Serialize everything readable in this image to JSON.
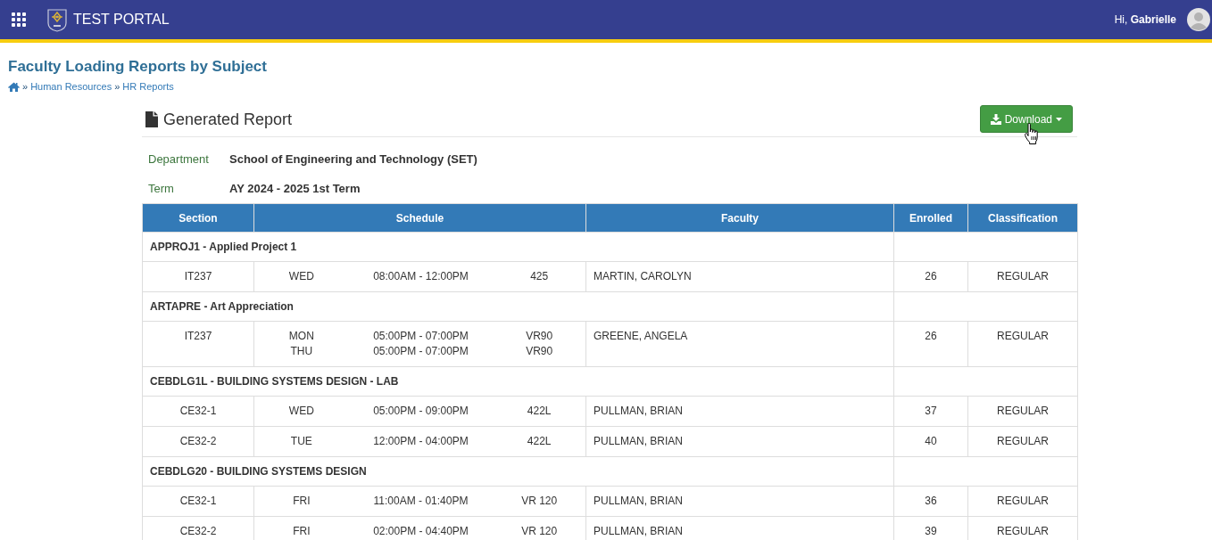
{
  "header": {
    "title": "TEST PORTAL",
    "greeting": "Hi, **Gabrielle**"
  },
  "page": {
    "title": "Faculty Loading Reports by Subject",
    "breadcrumbs": [
      {
        "kind": "home"
      },
      {
        "kind": "separator",
        "text": "»"
      },
      {
        "kind": "link",
        "text": "Human Resources"
      },
      {
        "kind": "separator",
        "text": "»"
      },
      {
        "kind": "link",
        "text": "HR Reports"
      }
    ]
  },
  "report": {
    "title": "Generated Report",
    "download_button": "Download",
    "details": [
      {
        "label": "Department",
        "value": "School of Engineering and Technology (SET)"
      },
      {
        "label": "Term",
        "value": "AY 2024 - 2025 1st Term"
      }
    ]
  },
  "table": {
    "columns": [
      "Section",
      "Schedule",
      "Faculty",
      "Enrolled",
      "Classification"
    ],
    "groups": [
      {
        "subject": "APPROJ1 - Applied Project 1",
        "rows": [
          {
            "section": "IT237",
            "schedule": [
              {
                "day": "WED",
                "time": "08:00AM - 12:00PM",
                "room": "425"
              }
            ],
            "faculty": "MARTIN, CAROLYN",
            "enrolled": "26",
            "classification": "REGULAR"
          }
        ]
      },
      {
        "subject": "ARTAPRE - Art Appreciation",
        "rows": [
          {
            "section": "IT237",
            "schedule": [
              {
                "day": "MON",
                "time": "05:00PM - 07:00PM",
                "room": "VR90"
              },
              {
                "day": "THU",
                "time": "05:00PM - 07:00PM",
                "room": "VR90"
              }
            ],
            "faculty": "GREENE, ANGELA",
            "enrolled": "26",
            "classification": "REGULAR"
          }
        ]
      },
      {
        "subject": "CEBDLG1L - BUILDING SYSTEMS DESIGN - LAB",
        "rows": [
          {
            "section": "CE32-1",
            "schedule": [
              {
                "day": "WED",
                "time": "05:00PM - 09:00PM",
                "room": "422L"
              }
            ],
            "faculty": "PULLMAN, BRIAN",
            "enrolled": "37",
            "classification": "REGULAR"
          },
          {
            "section": "CE32-2",
            "schedule": [
              {
                "day": "TUE",
                "time": "12:00PM - 04:00PM",
                "room": "422L"
              }
            ],
            "faculty": "PULLMAN, BRIAN",
            "enrolled": "40",
            "classification": "REGULAR"
          }
        ]
      },
      {
        "subject": "CEBDLG20 - BUILDING SYSTEMS DESIGN",
        "rows": [
          {
            "section": "CE32-1",
            "schedule": [
              {
                "day": "FRI",
                "time": "11:00AM - 01:40PM",
                "room": "VR 120"
              }
            ],
            "faculty": "PULLMAN, BRIAN",
            "enrolled": "36",
            "classification": "REGULAR"
          },
          {
            "section": "CE32-2",
            "schedule": [
              {
                "day": "FRI",
                "time": "02:00PM - 04:40PM",
                "room": "VR 120"
              }
            ],
            "faculty": "PULLMAN, BRIAN",
            "enrolled": "39",
            "classification": "REGULAR"
          }
        ]
      }
    ]
  }
}
